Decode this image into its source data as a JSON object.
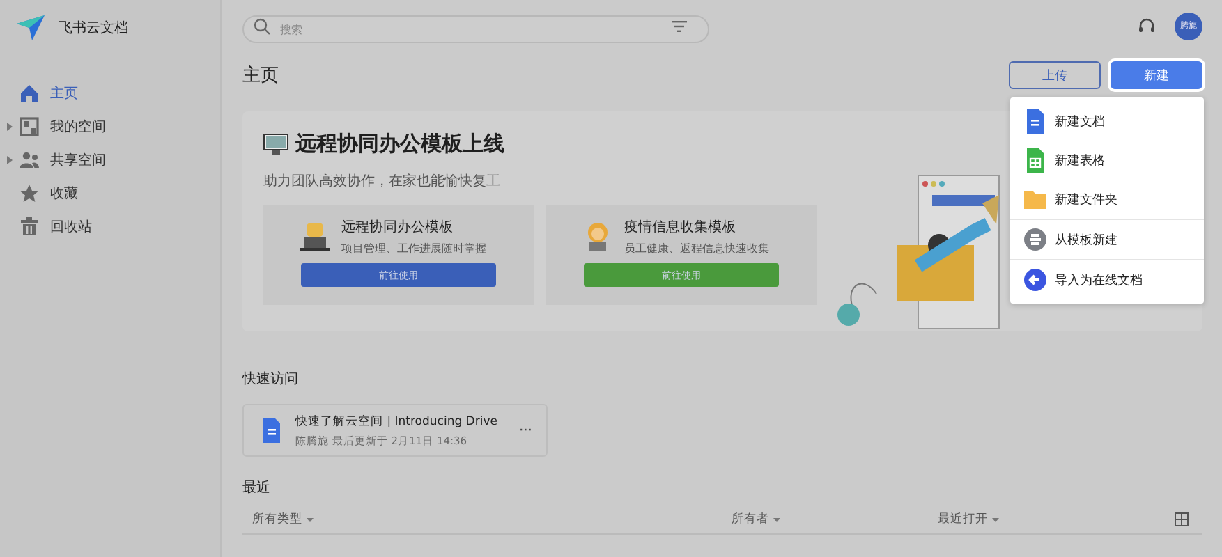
{
  "app": {
    "name": "飞书云文档"
  },
  "sidebar": {
    "items": [
      {
        "label": "主页",
        "kind": "home",
        "selected": true,
        "expandable": false
      },
      {
        "label": "我的空间",
        "kind": "space",
        "selected": false,
        "expandable": true
      },
      {
        "label": "共享空间",
        "kind": "people",
        "selected": false,
        "expandable": true
      },
      {
        "label": "收藏",
        "kind": "star",
        "selected": false,
        "expandable": false
      },
      {
        "label": "回收站",
        "kind": "trash",
        "selected": false,
        "expandable": false
      }
    ]
  },
  "search": {
    "placeholder": "搜索"
  },
  "user": {
    "avatar": "腾旎"
  },
  "page_title": "主页",
  "actions": [
    {
      "label": "上传",
      "kind": "outline"
    },
    {
      "label": "新建",
      "kind": "primary"
    }
  ],
  "new_menu": {
    "items": [
      {
        "label": "新建文档",
        "kind": "doc",
        "divider_before": false
      },
      {
        "label": "新建表格",
        "kind": "sheet",
        "divider_before": false
      },
      {
        "label": "新建文件夹",
        "kind": "folder",
        "divider_before": false
      },
      {
        "label": "从模板新建",
        "kind": "template",
        "divider_before": true
      },
      {
        "label": "导入为在线文档",
        "kind": "import",
        "divider_before": true
      }
    ]
  },
  "banner": {
    "title": "远程协同办公模板上线",
    "subtitle": "助力团队高效协作，在家也能愉快复工",
    "templates": [
      {
        "title": "远程协同办公模板",
        "description": "项目管理、工作进展随时掌握",
        "button": "前往使用",
        "color": "#3a5fb8"
      },
      {
        "title": "疫情信息收集模板",
        "description": "员工健康、返程信息快速收集",
        "button": "前往使用",
        "color": "#4a9a3c"
      }
    ]
  },
  "quick_access": {
    "title": "快速访问",
    "items": [
      {
        "name": "快速了解云空间 | Introducing Drive",
        "meta": "陈腾旎 最后更新于 2月11日 14:36",
        "more": "···"
      }
    ]
  },
  "recent": {
    "title": "最近",
    "columns": [
      "所有类型",
      "所有者",
      "最近打开"
    ]
  }
}
